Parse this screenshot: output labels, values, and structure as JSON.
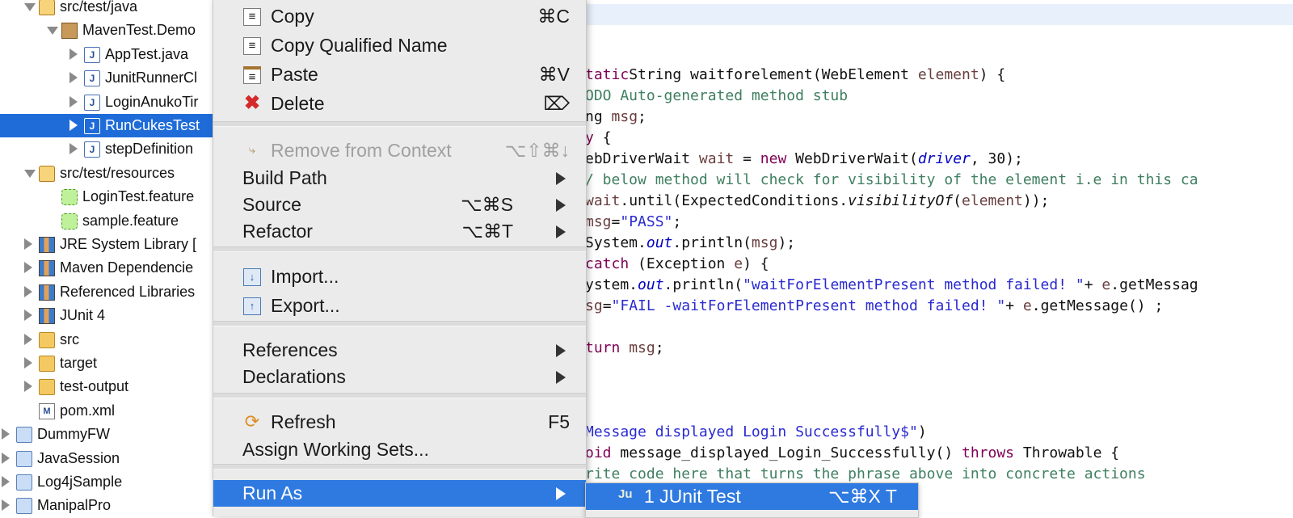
{
  "tree": [
    {
      "label": "src/test/java",
      "icon": "package-folder-icon",
      "indent": 34,
      "arrow": "open"
    },
    {
      "label": "MavenTest.Demo",
      "icon": "package-icon",
      "indent": 62,
      "arrow": "open"
    },
    {
      "label": "AppTest.java",
      "icon": "java-file-icon",
      "indent": 90,
      "arrow": "closed"
    },
    {
      "label": "JunitRunnerCl",
      "icon": "java-file-icon",
      "indent": 90,
      "arrow": "closed"
    },
    {
      "label": "LoginAnukoTir",
      "icon": "java-file-icon",
      "indent": 90,
      "arrow": "closed"
    },
    {
      "label": "RunCukesTest",
      "icon": "java-file-icon",
      "indent": 90,
      "arrow": "closed",
      "selected": true
    },
    {
      "label": "stepDefinition",
      "icon": "java-file-icon",
      "indent": 90,
      "arrow": "closed"
    },
    {
      "label": "src/test/resources",
      "icon": "package-folder-icon",
      "indent": 34,
      "arrow": "open"
    },
    {
      "label": "LoginTest.feature",
      "icon": "feature-file-icon",
      "indent": 62,
      "arrow": "none"
    },
    {
      "label": "sample.feature",
      "icon": "feature-file-icon",
      "indent": 62,
      "arrow": "none"
    },
    {
      "label": "JRE System Library [",
      "icon": "library-icon",
      "indent": 34,
      "arrow": "closed"
    },
    {
      "label": "Maven Dependencie",
      "icon": "library-icon",
      "indent": 34,
      "arrow": "closed"
    },
    {
      "label": "Referenced Libraries",
      "icon": "library-icon",
      "indent": 34,
      "arrow": "closed"
    },
    {
      "label": "JUnit 4",
      "icon": "library-icon",
      "indent": 34,
      "arrow": "closed"
    },
    {
      "label": "src",
      "icon": "folder-icon",
      "indent": 34,
      "arrow": "closed"
    },
    {
      "label": "target",
      "icon": "folder-icon",
      "indent": 34,
      "arrow": "closed"
    },
    {
      "label": "test-output",
      "icon": "folder-icon",
      "indent": 34,
      "arrow": "closed"
    },
    {
      "label": "pom.xml",
      "icon": "xml-file-icon",
      "indent": 34,
      "arrow": "none"
    },
    {
      "label": "DummyFW",
      "icon": "project-icon",
      "indent": 6,
      "arrow": "closed"
    },
    {
      "label": "JavaSession",
      "icon": "project-icon",
      "indent": 6,
      "arrow": "closed"
    },
    {
      "label": "Log4jSample",
      "icon": "project-icon",
      "indent": 6,
      "arrow": "closed"
    },
    {
      "label": "ManipalPro",
      "icon": "project-icon",
      "indent": 6,
      "arrow": "closed"
    }
  ],
  "editor": {
    "lines": [
      [],
      [],
      [],
      [
        [
          "kw",
          "tatic"
        ],
        [
          "",
          "String waitforelement(WebElement "
        ],
        [
          "var",
          "element"
        ],
        [
          "",
          ") {"
        ]
      ],
      [
        [
          "cmt",
          "ODO Auto-generated method stub"
        ]
      ],
      [
        [
          "",
          "ng "
        ],
        [
          "var",
          "msg"
        ],
        [
          "",
          ";"
        ]
      ],
      [
        [
          "kw",
          "y"
        ],
        [
          "",
          " {"
        ]
      ],
      [
        [
          "",
          "ebDriverWait "
        ],
        [
          "var",
          "wait"
        ],
        [
          "",
          " = "
        ],
        [
          "kw",
          "new"
        ],
        [
          "",
          " WebDriverWait("
        ],
        [
          "fld",
          "driver"
        ],
        [
          "",
          ", 30);"
        ]
      ],
      [
        [
          "cmt",
          "/ below method will check for visibility of the element i.e in this ca"
        ]
      ],
      [
        [
          "var",
          "wait"
        ],
        [
          "",
          ".until(ExpectedConditions."
        ],
        [
          "it",
          "visibilityOf"
        ],
        [
          "",
          "("
        ],
        [
          "var",
          "element"
        ],
        [
          "",
          "));"
        ]
      ],
      [
        [
          "var",
          "msg"
        ],
        [
          "",
          "="
        ],
        [
          "str",
          "\"PASS\""
        ],
        [
          "",
          ";"
        ]
      ],
      [
        [
          "",
          "System."
        ],
        [
          "fld",
          "out"
        ],
        [
          "",
          ".println("
        ],
        [
          "var",
          "msg"
        ],
        [
          "",
          ");"
        ]
      ],
      [
        [
          "kw",
          "catch"
        ],
        [
          "",
          " (Exception "
        ],
        [
          "var",
          "e"
        ],
        [
          "",
          ") {"
        ]
      ],
      [
        [
          "",
          "ystem."
        ],
        [
          "fld",
          "out"
        ],
        [
          "",
          ".println("
        ],
        [
          "str",
          "\"waitForElementPresent method failed! \""
        ],
        [
          "",
          "+ "
        ],
        [
          "var",
          "e"
        ],
        [
          "",
          ".getMessag"
        ]
      ],
      [
        [
          "var",
          "sg"
        ],
        [
          "",
          "="
        ],
        [
          "str",
          "\"FAIL -waitForElementPresent method failed! \""
        ],
        [
          "",
          "+ "
        ],
        [
          "var",
          "e"
        ],
        [
          "",
          ".getMessage() ;"
        ]
      ],
      [],
      [
        [
          "kw",
          "turn"
        ],
        [
          "",
          " "
        ],
        [
          "var",
          "msg"
        ],
        [
          "",
          ";"
        ]
      ],
      [],
      [],
      [],
      [
        [
          "str",
          "Message displayed Login Successfully$\""
        ],
        [
          "",
          ")"
        ]
      ],
      [
        [
          "kw",
          "oid"
        ],
        [
          "",
          " message_displayed_Login_Successfully() "
        ],
        [
          "kw",
          "throws"
        ],
        [
          "",
          " Throwable {"
        ]
      ],
      [
        [
          "cmt",
          "rite code here that turns the phrase above into concrete actions"
        ]
      ],
      [
        [
          "",
          "                           );"
        ]
      ]
    ]
  },
  "menu": {
    "items": [
      {
        "type": "item",
        "label": "Copy",
        "icon": "copy-icon",
        "shortcut": "⌘C"
      },
      {
        "type": "item",
        "label": "Copy Qualified Name",
        "icon": "copy-qualified-name-icon",
        "shortcut": ""
      },
      {
        "type": "item",
        "label": "Paste",
        "icon": "paste-icon",
        "shortcut": "⌘V"
      },
      {
        "type": "item",
        "label": "Delete",
        "icon": "delete-icon",
        "shortcut": "⌦"
      },
      {
        "type": "sep"
      },
      {
        "type": "item",
        "label": "Remove from Context",
        "icon": "remove-from-context-icon",
        "shortcut": "⌥⇧⌘↓",
        "disabled": true
      },
      {
        "type": "item",
        "label": "Build Path",
        "icon": "",
        "shortcut": "",
        "submenu": true
      },
      {
        "type": "item",
        "label": "Source",
        "icon": "",
        "shortcut": "⌥⌘S",
        "submenu": true
      },
      {
        "type": "item",
        "label": "Refactor",
        "icon": "",
        "shortcut": "⌥⌘T",
        "submenu": true
      },
      {
        "type": "sep"
      },
      {
        "type": "item",
        "label": "Import...",
        "icon": "import-icon",
        "shortcut": ""
      },
      {
        "type": "item",
        "label": "Export...",
        "icon": "export-icon",
        "shortcut": ""
      },
      {
        "type": "sep"
      },
      {
        "type": "item",
        "label": "References",
        "icon": "",
        "shortcut": "",
        "submenu": true
      },
      {
        "type": "item",
        "label": "Declarations",
        "icon": "",
        "shortcut": "",
        "submenu": true
      },
      {
        "type": "sep"
      },
      {
        "type": "item",
        "label": "Refresh",
        "icon": "refresh-icon",
        "shortcut": "F5"
      },
      {
        "type": "item",
        "label": "Assign Working Sets...",
        "icon": "",
        "shortcut": ""
      },
      {
        "type": "sep"
      },
      {
        "type": "item",
        "label": "Run As",
        "icon": "",
        "shortcut": "",
        "submenu": true,
        "active": true
      }
    ]
  },
  "submenu": {
    "label": "1 JUnit Test",
    "icon": "junit-icon",
    "shortcut": "⌥⌘X T"
  },
  "colors": {
    "selection": "#1f6cd9",
    "menu_highlight": "#2f7ae0",
    "keyword": "#7f0055",
    "string": "#2a2ad1",
    "comment": "#3f7f5f"
  }
}
